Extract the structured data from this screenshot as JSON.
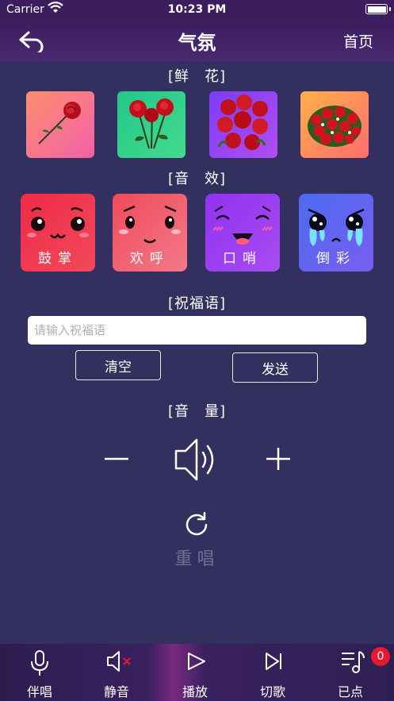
{
  "status_bar": {
    "carrier": "Carrier",
    "time": "10:23 PM"
  },
  "nav": {
    "title": "气氛",
    "home_label": "首页"
  },
  "flowers": {
    "title": "[鲜　花]",
    "items": [
      {
        "name": "single-rose",
        "bg": "#f77a8a"
      },
      {
        "name": "three-roses",
        "bg": "#2dcf86"
      },
      {
        "name": "rose-bouquet",
        "bg": "#9b3cf2"
      },
      {
        "name": "rose-basket",
        "bg": "#ff9d40"
      }
    ]
  },
  "sound_effects": {
    "title": "[音　效]",
    "items": [
      {
        "label": "鼓掌",
        "bg": "#f0334a"
      },
      {
        "label": "欢呼",
        "bg": "#f0607a"
      },
      {
        "label": "口哨",
        "bg": "#9b3cf2"
      },
      {
        "label": "倒彩",
        "bg": "#5b63e6"
      }
    ]
  },
  "wishes": {
    "title": "[祝福语]",
    "placeholder": "请输入祝福语",
    "value": "",
    "clear_label": "清空",
    "send_label": "发送"
  },
  "volume": {
    "title": "[音　量]"
  },
  "replay": {
    "label": "重唱"
  },
  "tabbar": {
    "items": [
      {
        "label": "伴唱",
        "icon": "microphone-icon"
      },
      {
        "label": "静音",
        "icon": "mute-icon"
      },
      {
        "label": "播放",
        "icon": "play-icon"
      },
      {
        "label": "切歌",
        "icon": "next-track-icon"
      },
      {
        "label": "已点",
        "icon": "playlist-icon"
      }
    ],
    "queued_count": "0"
  },
  "colors": {
    "background": "#332f5e",
    "nav_bg": "#3c1e5f",
    "badge": "#e8192c"
  }
}
